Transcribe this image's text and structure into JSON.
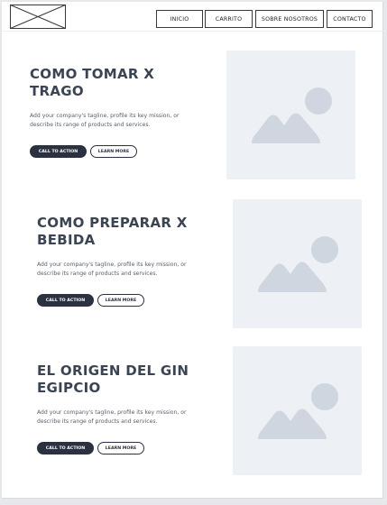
{
  "header": {
    "logo_icon": "image-placeholder-icon",
    "nav": [
      {
        "label": "INICIO"
      },
      {
        "label": "CARRITO"
      },
      {
        "label": "SOBRE NOSOTROS"
      },
      {
        "label": "CONTACTO"
      }
    ]
  },
  "sections": [
    {
      "title_line1": "COMO TOMAR X",
      "title_line2": "TRAGO",
      "tagline_line1": "Add your company's tagline, profile its key mission, or",
      "tagline_line2": "describe its range of products and services.",
      "primary_label": "CALL TO ACTION",
      "secondary_label": "LEARN MORE",
      "image_icon": "image-placeholder-icon"
    },
    {
      "title_line1": "COMO PREPARAR X",
      "title_line2": "BEBIDA",
      "tagline_line1": "Add your company's tagline, profile its key mission, or",
      "tagline_line2": "describe its range of products and services.",
      "primary_label": "CALL TO ACTION",
      "secondary_label": "LEARN MORE",
      "image_icon": "image-placeholder-icon"
    },
    {
      "title_line1": "EL ORIGEN DEL GIN",
      "title_line2": "EGIPCIO",
      "tagline_line1": "Add your company's tagline, profile its key mission, or",
      "tagline_line2": "describe its range of products and services.",
      "primary_label": "CALL TO ACTION",
      "secondary_label": "LEARN MORE",
      "image_icon": "image-placeholder-icon"
    }
  ],
  "colors": {
    "page_background": "#ffffff",
    "outer_background": "#e6e8eb",
    "text": "#3b4452",
    "primary_button": "#2b3140",
    "image_placeholder": "#edf0f4",
    "image_glyph": "#cfd6df"
  }
}
